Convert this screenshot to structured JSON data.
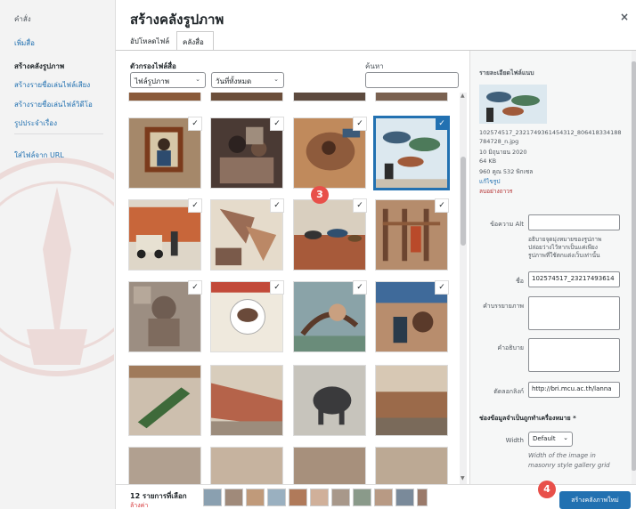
{
  "sidebar": {
    "title": "คำสั่ง",
    "items": [
      {
        "label": "เพิ่มสื่อ",
        "active": false
      },
      {
        "label": "สร้างคลังรูปภาพ",
        "active": true
      },
      {
        "label": "สร้างรายชื่อเล่นไฟล์เสียง",
        "active": false
      },
      {
        "label": "สร้างรายชื่อเล่นไฟล์วิดีโอ",
        "active": false
      },
      {
        "label": "รูปประจำเรื่อง",
        "active": false
      }
    ],
    "insert_url": "ใส่ไฟล์จาก URL"
  },
  "header": {
    "title": "สร้างคลังรูปภาพ",
    "close_icon": "×",
    "tabs": [
      {
        "label": "อัปโหลดไฟล์"
      },
      {
        "label": "คลังสื่อ"
      }
    ]
  },
  "filters": {
    "label": "ตัวกรองไฟล์สื่อ",
    "type_select": "ไฟล์รูปภาพ",
    "date_select": "วันที่ทั้งหมด",
    "search_label": "ค้นหา",
    "search_value": ""
  },
  "grid": {
    "items": [
      {
        "name": "portrait-frame",
        "checked": true,
        "selected": false
      },
      {
        "name": "performers",
        "checked": true,
        "selected": false
      },
      {
        "name": "mural-figure",
        "checked": true,
        "selected": false
      },
      {
        "name": "fish-mural",
        "checked": true,
        "selected": true
      },
      {
        "name": "truck-wall",
        "checked": true,
        "selected": false
      },
      {
        "name": "hands-mural",
        "checked": true,
        "selected": false
      },
      {
        "name": "wall-fish",
        "checked": true,
        "selected": false
      },
      {
        "name": "weaving",
        "checked": true,
        "selected": false
      },
      {
        "name": "carved-panel",
        "checked": true,
        "selected": false
      },
      {
        "name": "plate-mural",
        "checked": true,
        "selected": false
      },
      {
        "name": "fishing-mural",
        "checked": true,
        "selected": false
      },
      {
        "name": "painter-mural",
        "checked": true,
        "selected": false
      },
      {
        "name": "leaf-mural",
        "checked": false,
        "selected": false
      },
      {
        "name": "long-wall",
        "checked": false,
        "selected": false
      },
      {
        "name": "elephant-mural",
        "checked": false,
        "selected": false
      },
      {
        "name": "fence-mural",
        "checked": false,
        "selected": false
      },
      {
        "name": "row5-a",
        "checked": false,
        "selected": false
      },
      {
        "name": "row5-b",
        "checked": false,
        "selected": false
      },
      {
        "name": "row5-c",
        "checked": false,
        "selected": false
      },
      {
        "name": "row5-d",
        "checked": false,
        "selected": false
      }
    ],
    "check_glyph": "✓"
  },
  "badges": {
    "grid_step": "3",
    "footer_step": "4"
  },
  "details": {
    "heading": "รายละเอียดไฟล์แนบ",
    "filename_line1": "102574517_2321749361454312_806418334188",
    "filename_line2": "784728_n.jpg",
    "date": "10 มิถุนายน 2020",
    "size": "64 KB",
    "dimensions": "960 คูณ 532 พิกเซล",
    "edit_link": "แก้ไขรูป",
    "delete_link": "ลบอย่างถาวร",
    "alt_label": "ข้อความ Alt",
    "alt_value": "",
    "alt_help_link": "อธิบายจุดมุ่งหมายของรูปภาพ",
    "alt_help_1": "ปล่อยว่างไว้หากเป็นแค่เพียง",
    "alt_help_2": "รูปภาพที่ใช้ตกแต่งเว็บเท่านั้น",
    "title_label": "ชื่อ",
    "title_value": "102574517_23217493614",
    "caption_label": "คำบรรยายภาพ",
    "description_label": "คำอธิบาย",
    "file_url_label": "ตัดลอกลิงก์",
    "file_url_value": "http://bri.mcu.ac.th/lanna",
    "gallery_settings": "ช่องข้อมูลจำเป็นถูกทำเครื่องหมาย *",
    "width_label": "Width",
    "width_value": "Default",
    "width_help_1": "Width of the image in",
    "width_help_2": "masonry style gallery grid"
  },
  "footer": {
    "count": "12 รายการที่เลือก",
    "clear": "ล้างค่า",
    "button": "สร้างคลังภาพใหม่"
  },
  "colors": {
    "accent": "#2271b1",
    "badge": "#e8504a",
    "danger": "#d63638"
  }
}
